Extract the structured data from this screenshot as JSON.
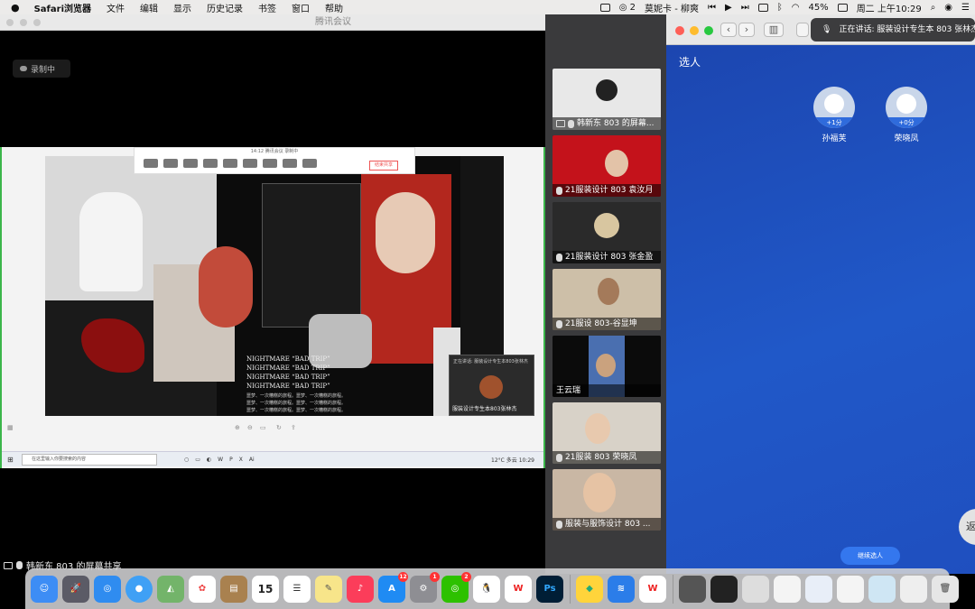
{
  "menubar": {
    "app": "Safari浏览器",
    "items": [
      "文件",
      "编辑",
      "显示",
      "历史记录",
      "书签",
      "窗口",
      "帮助"
    ],
    "wechat_badge": "2",
    "now_playing": "莫妮卡 - 柳爽",
    "battery": "45%",
    "clock": "周二 上午10:29"
  },
  "meeting": {
    "window_title": "腾讯会议",
    "recording": "录制中",
    "share_caption": "韩新东 803 的屏幕共享",
    "toolbar_top": "14:12  腾讯会议    录制中",
    "end_share": "结束共享",
    "nightmare_lines": [
      "NIGHTMARE “BAD TRIP”",
      "NIGHTMARE “BAD TRIP”",
      "NIGHTMARE “BAD TRIP”",
      "NIGHTMARE “BAD TRIP”"
    ],
    "zh_lines": [
      "噩梦、一次糟糕的旅程。噩梦、一次糟糕的旅程。",
      "噩梦、一次糟糕的旅程。噩梦、一次糟糕的旅程。",
      "噩梦、一次糟糕的旅程。噩梦、一次糟糕的旅程。"
    ],
    "float_title": "正在讲话: 服装设计专生本803张林杰",
    "float_name": "服装设计专生本803张林杰",
    "win_search": "在这里输入你要搜索的内容",
    "win_tray": "12°C 多云",
    "win_clock": "10:29"
  },
  "gallery": [
    {
      "name": "韩新东 803 的屏幕...",
      "bg": "#e8e8e8"
    },
    {
      "name": "21服装设计 803 袁汝月",
      "bg": "#c4121b"
    },
    {
      "name": "21服装设计 803 张金盈",
      "bg": "#2a2a2a"
    },
    {
      "name": "21服设 803-谷显坤",
      "bg": "#cdbfa8"
    },
    {
      "name": "王云瑞",
      "bg": "#0b0b0b"
    },
    {
      "name": "21服装 803 荣晓凤",
      "bg": "#d8d2c8"
    },
    {
      "name": "服装与服饰设计 803 ...",
      "bg": "#c9b7a4"
    }
  ],
  "safari": {
    "notification": "正在讲话: 服装设计专生本 803 张林杰",
    "title": "选人",
    "candidates": [
      {
        "name": "孙福芙",
        "score": "+1分"
      },
      {
        "name": "荣晓凤",
        "score": "+0分"
      }
    ],
    "continue": "继续选人",
    "side_tab": "返"
  },
  "dock": {
    "calendar_day": "15",
    "appstore_badge": "12",
    "settings_badge": "1",
    "wechat_badge": "2",
    "ps_label": "Ps",
    "wps_label": "W"
  }
}
